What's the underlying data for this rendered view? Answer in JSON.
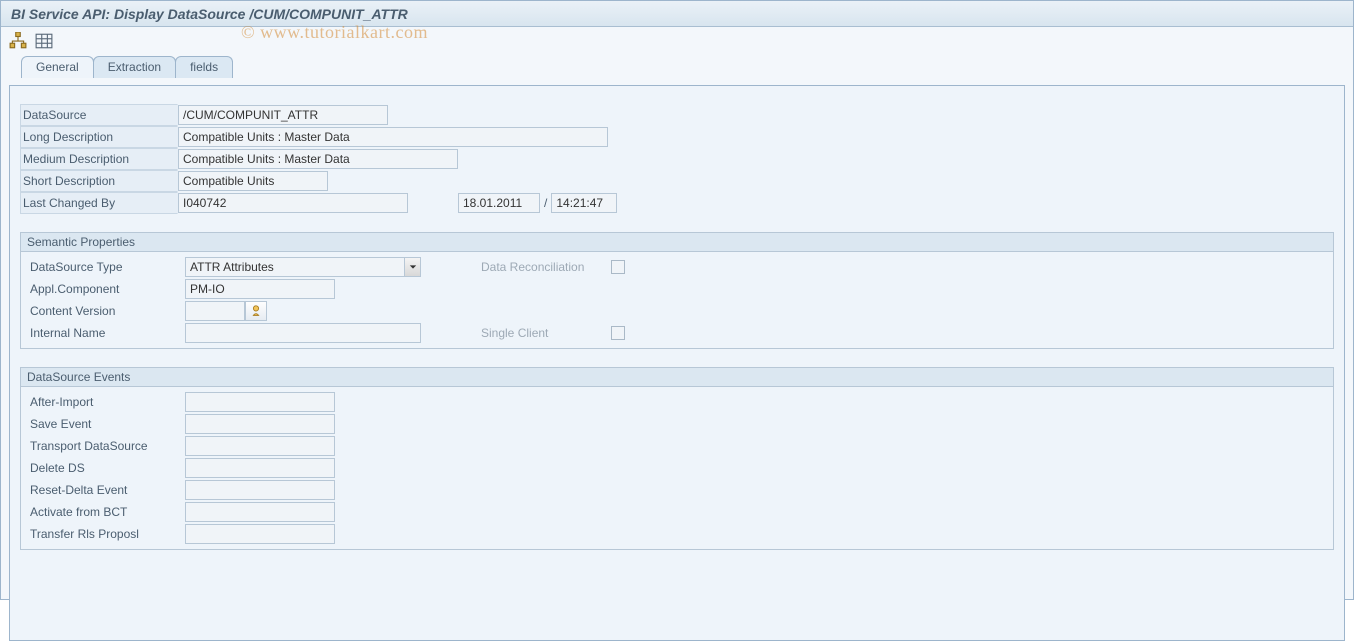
{
  "window": {
    "title": "BI Service API: Display DataSource /CUM/COMPUNIT_ATTR"
  },
  "watermark": "© www.tutorialkart.com",
  "tabs": {
    "general": "General",
    "extraction": "Extraction",
    "fields": "fields"
  },
  "general": {
    "labels": {
      "datasource": "DataSource",
      "long_desc": "Long Description",
      "medium_desc": "Medium Description",
      "short_desc": "Short Description",
      "last_changed_by": "Last Changed By"
    },
    "values": {
      "datasource": "/CUM/COMPUNIT_ATTR",
      "long_desc": "Compatible Units : Master Data",
      "medium_desc": "Compatible Units : Master Data",
      "short_desc": "Compatible Units",
      "last_changed_by": "I040742",
      "last_changed_date": "18.01.2011",
      "last_changed_time": "14:21:47"
    }
  },
  "semantic": {
    "title": "Semantic Properties",
    "labels": {
      "ds_type": "DataSource Type",
      "appl_component": "Appl.Component",
      "content_version": "Content Version",
      "internal_name": "Internal Name",
      "data_reconciliation": "Data Reconciliation",
      "single_client": "Single Client"
    },
    "values": {
      "ds_type": "ATTR Attributes",
      "appl_component": "PM-IO",
      "content_version": "",
      "internal_name": ""
    }
  },
  "events": {
    "title": "DataSource Events",
    "labels": {
      "after_import": "After-Import",
      "save_event": "Save Event",
      "transport_ds": "Transport DataSource",
      "delete_ds": "Delete DS",
      "reset_delta": "Reset-Delta Event",
      "activate_bct": "Activate from BCT",
      "transfer_rls": "Transfer Rls Proposl"
    },
    "values": {
      "after_import": "",
      "save_event": "",
      "transport_ds": "",
      "delete_ds": "",
      "reset_delta": "",
      "activate_bct": "",
      "transfer_rls": ""
    }
  }
}
